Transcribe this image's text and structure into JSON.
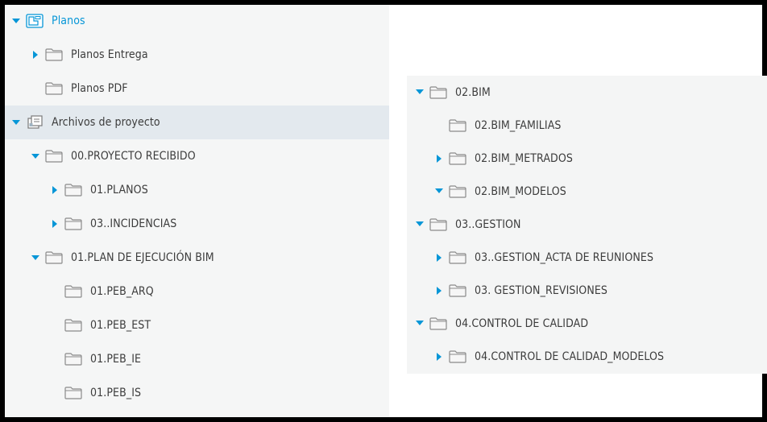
{
  "left_tree": [
    {
      "label": "Planos",
      "caret": "down",
      "icon": "plan-folder-icon",
      "level": 0,
      "link": true
    },
    {
      "label": "Planos Entrega",
      "caret": "right",
      "icon": "folder-icon",
      "level": 1
    },
    {
      "label": "Planos PDF",
      "caret": "none",
      "icon": "folder-icon",
      "level": 1
    },
    {
      "label": "Archivos de proyecto",
      "caret": "down",
      "icon": "project-files-icon",
      "level": 0,
      "selected": true
    },
    {
      "label": "00.PROYECTO RECIBIDO",
      "caret": "down",
      "icon": "folder-icon",
      "level": 1
    },
    {
      "label": "01.PLANOS",
      "caret": "right",
      "icon": "folder-icon",
      "level": 2
    },
    {
      "label": "03..INCIDENCIAS",
      "caret": "right",
      "icon": "folder-icon",
      "level": 2
    },
    {
      "label": "01.PLAN DE EJECUCIÓN BIM",
      "caret": "down",
      "icon": "folder-icon",
      "level": 1
    },
    {
      "label": "01.PEB_ARQ",
      "caret": "none",
      "icon": "folder-icon",
      "level": 2
    },
    {
      "label": "01.PEB_EST",
      "caret": "none",
      "icon": "folder-icon",
      "level": 2
    },
    {
      "label": "01.PEB_IE",
      "caret": "none",
      "icon": "folder-icon",
      "level": 2
    },
    {
      "label": "01.PEB_IS",
      "caret": "none",
      "icon": "folder-icon",
      "level": 2
    }
  ],
  "right_tree": [
    {
      "label": "02.BIM",
      "caret": "down",
      "icon": "folder-icon",
      "level": 0
    },
    {
      "label": "02.BIM_FAMILIAS",
      "caret": "none",
      "icon": "folder-icon",
      "level": 1
    },
    {
      "label": "02.BIM_METRADOS",
      "caret": "right",
      "icon": "folder-icon",
      "level": 1
    },
    {
      "label": "02.BIM_MODELOS",
      "caret": "down",
      "icon": "folder-icon",
      "level": 1
    },
    {
      "label": "03..GESTION",
      "caret": "down",
      "icon": "folder-icon",
      "level": 0
    },
    {
      "label": "03..GESTION_ACTA DE REUNIONES",
      "caret": "right",
      "icon": "folder-icon",
      "level": 1
    },
    {
      "label": "03. GESTION_REVISIONES",
      "caret": "right",
      "icon": "folder-icon",
      "level": 1
    },
    {
      "label": "04.CONTROL DE CALIDAD",
      "caret": "down",
      "icon": "folder-icon",
      "level": 0
    },
    {
      "label": "04.CONTROL DE CALIDAD_MODELOS",
      "caret": "right",
      "icon": "folder-icon",
      "level": 1
    }
  ],
  "colors": {
    "accent": "#0696d7",
    "folder_stroke": "#8a8a8a",
    "selected_bg": "#e3e9ee",
    "text": "#3c3c3c"
  }
}
